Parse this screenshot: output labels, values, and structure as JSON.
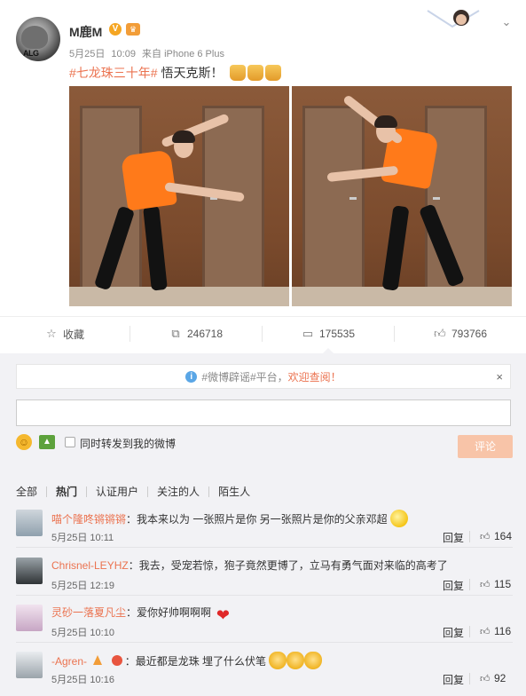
{
  "post": {
    "username": "M鹿M",
    "date": "5月25日",
    "time": "10:09",
    "source": "来自 iPhone 6 Plus",
    "topic": "#七龙珠三十年#",
    "text": " 悟天克斯！",
    "avatar_tag": "ALG",
    "vip_badge": "V"
  },
  "actions": {
    "favorite_label": "收藏",
    "repost_count": "246718",
    "comment_count": "175535",
    "like_count": "793766"
  },
  "notice": {
    "prefix": "#微博辟谣#平台，",
    "highlight": "欢迎查阅！",
    "close": "×"
  },
  "composer": {
    "input_value": "",
    "repost_label": "同时转发到我的微博",
    "submit_label": "评论"
  },
  "tabs": [
    "全部",
    "热门",
    "认证用户",
    "关注的人",
    "陌生人"
  ],
  "comments": [
    {
      "user": "喵个隆咚锵锵锵",
      "text": "：我本来以为 一张照片是你 另一张照片是你的父亲邓超",
      "time": "5月25日 10:11",
      "reply": "回复",
      "likes": "164"
    },
    {
      "user": "Chrisnel-LEYHZ",
      "text": "：我去，受宠若惊，狍子竟然更博了，立马有勇气面对来临的高考了",
      "time": "5月25日 12:19",
      "reply": "回复",
      "likes": "115"
    },
    {
      "user": "灵砂一落夏凡尘",
      "text": "：爱你好帅啊啊啊",
      "time": "5月25日 10:10",
      "reply": "回复",
      "likes": "116"
    },
    {
      "user": "-Agren-",
      "text": "：最近都是龙珠 埋了什么伏笔",
      "time": "5月25日 10:16",
      "reply": "回复",
      "likes": "92"
    }
  ],
  "icons": {
    "favorite": "star-icon",
    "repost": "repost-icon",
    "comment": "comment-icon",
    "like": "thumbs-up-icon"
  },
  "colors": {
    "accent": "#eb7350",
    "submit_disabled": "#f8c4a8",
    "page_bg": "#f2f2f5"
  }
}
